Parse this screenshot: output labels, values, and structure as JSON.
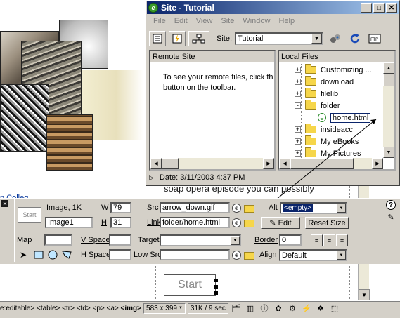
{
  "site_window": {
    "title": "Site - Tutorial",
    "menu": [
      "File",
      "Edit",
      "View",
      "Site",
      "Window",
      "Help"
    ],
    "site_label": "Site:",
    "site_value": "Tutorial",
    "remote_header": "Remote Site",
    "remote_message_line1": "To see your remote files, click th",
    "remote_message_line2": "button on the toolbar.",
    "local_header": "Local Files",
    "tree": [
      {
        "label": "Customizing ...",
        "expander": "+"
      },
      {
        "label": "download",
        "expander": "+"
      },
      {
        "label": "filelib",
        "expander": "+"
      },
      {
        "label": "folder",
        "expander": "-"
      },
      {
        "label": "home.html",
        "type": "file"
      },
      {
        "label": "insideacc",
        "expander": "+"
      },
      {
        "label": "My eBooks",
        "expander": "+"
      },
      {
        "label": "My Pictures",
        "expander": "+"
      }
    ],
    "status_date": "Date: 3/11/2003 4:37 PM"
  },
  "document": {
    "college_text": "n Colleg",
    "soap_text": "soap opera episode you can possibly",
    "start_button": "Start"
  },
  "properties": {
    "thumb_label": "Start",
    "image_type": "Image, 1K",
    "name_value": "Image1",
    "w_label": "W",
    "w_value": "79",
    "h_label": "H",
    "h_value": "31",
    "src_label": "Src",
    "src_value": "arrow_down.gif",
    "link_label": "Link",
    "link_value": "folder/home.html",
    "alt_label": "Alt",
    "alt_value": "<empty>",
    "edit_button": "Edit",
    "reset_button": "Reset Size",
    "map_label": "Map",
    "vspace_label": "V Space",
    "hspace_label": "H Space",
    "target_label": "Target",
    "lowsrc_label": "Low Src",
    "border_label": "Border",
    "border_value": "0",
    "align_label": "Align",
    "align_value": "Default"
  },
  "statusbar": {
    "tags": "e:editable> <table> <tr> <td> <p> <a>",
    "current_tag": "<img>",
    "window_size": "583 x 399",
    "download": "31K / 9 sec"
  },
  "colors": {
    "title_start": "#0a246a",
    "title_end": "#a6caf0",
    "chrome": "#d4d0c8",
    "link_blue": "#00339a"
  }
}
